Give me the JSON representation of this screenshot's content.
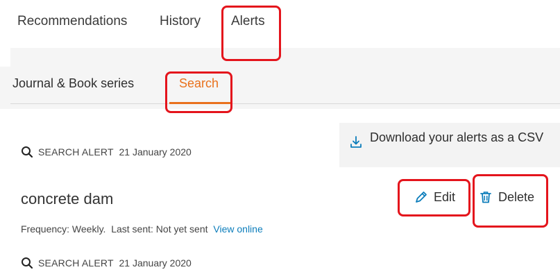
{
  "top_tabs": [
    {
      "label": "Recommendations"
    },
    {
      "label": "History"
    },
    {
      "label": "Alerts"
    }
  ],
  "sub_tabs": [
    {
      "label": "Journal & Book series"
    },
    {
      "label": "Search"
    }
  ],
  "download": {
    "label": "Download your alerts as a CSV"
  },
  "alerts": [
    {
      "type_label": "SEARCH ALERT",
      "date": "21 January 2020",
      "title": "concrete dam",
      "frequency": "Frequency: Weekly.",
      "last_sent": "Last sent: Not yet sent",
      "view_online": "View online"
    },
    {
      "type_label": "SEARCH ALERT",
      "date": "21 January 2020"
    }
  ],
  "actions": {
    "edit": "Edit",
    "delete": "Delete"
  },
  "colors": {
    "accent": "#e9711c",
    "link": "#0c7dbb",
    "highlight": "#e4141c"
  }
}
